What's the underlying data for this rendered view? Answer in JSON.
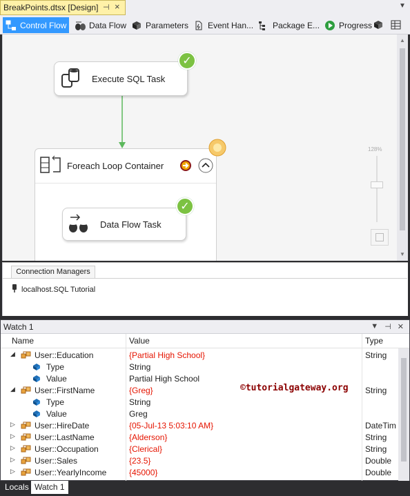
{
  "document_tab": {
    "title": "BreakPoints.dtsx [Design]",
    "pin_icon": "pin-icon",
    "close_icon": "close-icon"
  },
  "designer_tabs": [
    {
      "label": "Control Flow",
      "icon": "control-flow-icon",
      "active": true
    },
    {
      "label": "Data Flow",
      "icon": "data-flow-icon",
      "active": false
    },
    {
      "label": "Parameters",
      "icon": "parameters-icon",
      "active": false
    },
    {
      "label": "Event Han...",
      "icon": "event-handlers-icon",
      "active": false
    },
    {
      "label": "Package E...",
      "icon": "package-explorer-icon",
      "active": false
    },
    {
      "label": "Progress",
      "icon": "progress-icon",
      "active": false
    }
  ],
  "canvas": {
    "execute_sql_task": {
      "label": "Execute SQL Task",
      "status": "success"
    },
    "foreach_container": {
      "label": "Foreach Loop Container",
      "status": "breakpoint"
    },
    "data_flow_task": {
      "label": "Data Flow Task",
      "status": "success"
    },
    "zoom_label": "128%"
  },
  "connection_managers": {
    "tab_label": "Connection Managers",
    "items": [
      {
        "label": "localhost.SQL Tutorial"
      }
    ]
  },
  "watch": {
    "title": "Watch 1",
    "columns": {
      "name": "Name",
      "value": "Value",
      "type": "Type"
    },
    "rows": [
      {
        "name": "User::Education",
        "value": "{Partial High School}",
        "type": "String",
        "level": 0,
        "expander": "expanded"
      },
      {
        "name": "Type",
        "value": "String",
        "type": "",
        "level": 1,
        "expander": ""
      },
      {
        "name": "Value",
        "value": "Partial High School",
        "type": "",
        "level": 1,
        "expander": ""
      },
      {
        "name": "User::FirstName",
        "value": "{Greg}",
        "type": "String",
        "level": 0,
        "expander": "expanded"
      },
      {
        "name": "Type",
        "value": "String",
        "type": "",
        "level": 1,
        "expander": ""
      },
      {
        "name": "Value",
        "value": "Greg",
        "type": "",
        "level": 1,
        "expander": ""
      },
      {
        "name": "User::HireDate",
        "value": "{05-Jul-13 5:03:10 AM}",
        "type": "DateTim",
        "level": 0,
        "expander": "collapsed"
      },
      {
        "name": "User::LastName",
        "value": "{Alderson}",
        "type": "String",
        "level": 0,
        "expander": "collapsed"
      },
      {
        "name": "User::Occupation",
        "value": "{Clerical}",
        "type": "String",
        "level": 0,
        "expander": "collapsed"
      },
      {
        "name": "User::Sales",
        "value": "{23.5}",
        "type": "Double",
        "level": 0,
        "expander": "collapsed"
      },
      {
        "name": "User::YearlyIncome",
        "value": "{45000}",
        "type": "Double",
        "level": 0,
        "expander": "collapsed"
      }
    ],
    "watermark": "©tutorialgateway.org"
  },
  "bottom_tabs": [
    {
      "label": "Locals",
      "active": false
    },
    {
      "label": "Watch 1",
      "active": true
    }
  ],
  "colors": {
    "accent": "#3399ff",
    "success": "#7cc242",
    "value_red": "#e51400",
    "tab_yellow": "#fff1a8"
  }
}
